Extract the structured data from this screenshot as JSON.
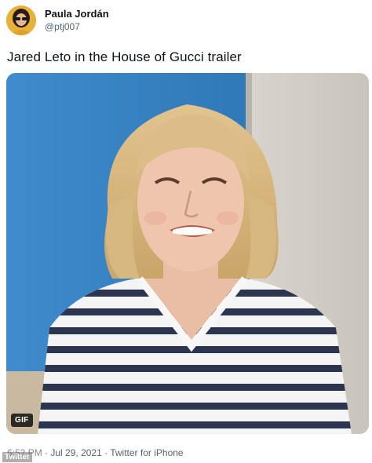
{
  "author": {
    "display_name": "Paula Jordán",
    "handle": "@ptj007"
  },
  "tweet": {
    "text": "Jared Leto in the House of Gucci trailer",
    "media_badge": "GIF"
  },
  "meta": {
    "time": "6:52 PM",
    "separator1": " · ",
    "date": "Jul 29, 2021",
    "separator2": " · ",
    "source": "Twitter for iPhone"
  },
  "watermark": "Twitter",
  "colors": {
    "text_primary": "#0f1419",
    "text_secondary": "#536471",
    "background": "#ffffff",
    "media_wall_blue": "#3a86c5"
  },
  "icons": {
    "avatar": "user-avatar",
    "gif": "gif-badge"
  }
}
